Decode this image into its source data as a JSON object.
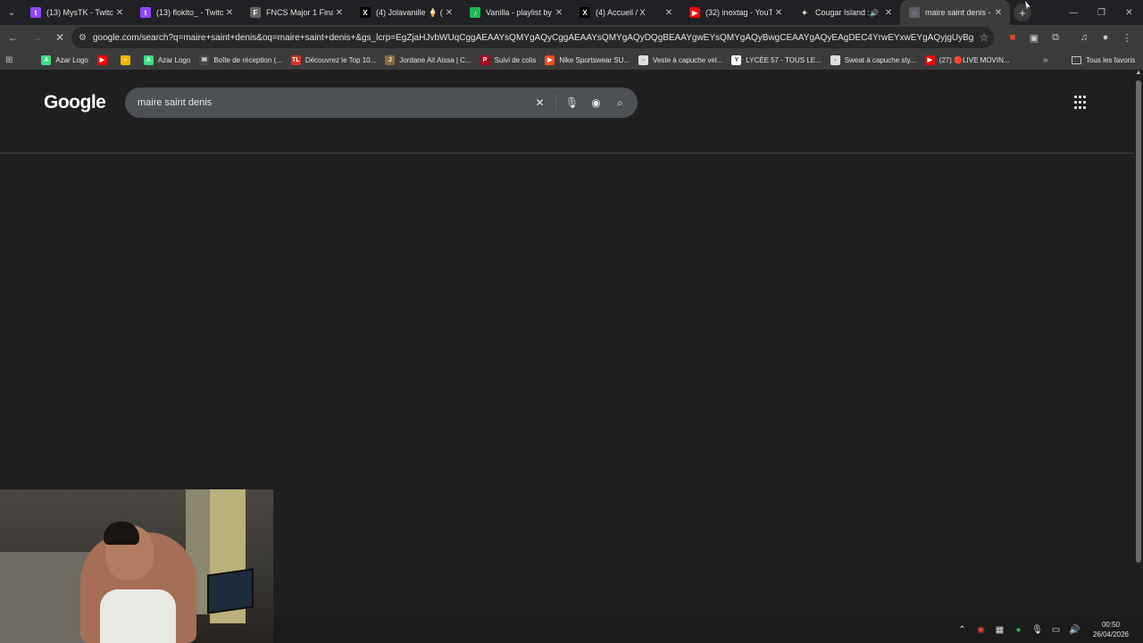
{
  "tabs": [
    {
      "title": "(13) MysTK - Twitch",
      "favicon_color": "#9146ff",
      "glyph": "t"
    },
    {
      "title": "(13) flokito_ - Twitch",
      "favicon_color": "#9146ff",
      "glyph": "t"
    },
    {
      "title": "FNCS Major 1 Finals",
      "favicon_color": "#666666",
      "glyph": "F"
    },
    {
      "title": "(4) Jolavanille 🍦 (@",
      "favicon_color": "#000000",
      "glyph": "X"
    },
    {
      "title": "Vanilla - playlist by Je",
      "favicon_color": "#1db954",
      "glyph": "♪"
    },
    {
      "title": "(4) Accueil / X",
      "favicon_color": "#000000",
      "glyph": "X"
    },
    {
      "title": "(32) inoxtag - YouTub",
      "favicon_color": "#ff0000",
      "glyph": "▶"
    },
    {
      "title": "Cougar Island : É",
      "favicon_color": "#222222",
      "glyph": "✦"
    },
    {
      "title": "maire saint denis - R",
      "favicon_color": "#5f6368",
      "glyph": "◌"
    }
  ],
  "toolbar": {
    "url": "google.com/search?q=maire+saint+denis&oq=maire+saint+denis+&gs_lcrp=EgZjaHJvbWUqCggAEAAYsQMYgAQyCggAEAAYsQMYgAQyDQgBEAAYgwEYsQMYgAQyBwgCEAAYgAQyEAgDEC4YrwEYxwEYgAQyjgUyBggEEAAYAzIHCAUQABi..."
  },
  "bookmarks": [
    {
      "label": "Azar Logo",
      "color": "#3ddc84",
      "glyph": "A"
    },
    {
      "label": "",
      "color": "#ff0000",
      "glyph": "▶"
    },
    {
      "label": "",
      "color": "#f4b400",
      "glyph": "▪"
    },
    {
      "label": "Azar Logo",
      "color": "#3ddc84",
      "glyph": "A"
    },
    {
      "label": "Boîte de réception (...",
      "color": "#4a4a4a",
      "glyph": "✉"
    },
    {
      "label": "Découvrez le Top 10...",
      "color": "#d93025",
      "glyph": "TL"
    },
    {
      "label": "Jordane Ait Aissa | C...",
      "color": "#8a6d3b",
      "glyph": "J"
    },
    {
      "label": "Suivi de colis",
      "color": "#b00020",
      "glyph": "P"
    },
    {
      "label": "Nike Sportswear SU...",
      "color": "#f25022",
      "glyph": "▶"
    },
    {
      "label": "Veste à capuche vel...",
      "color": "#e0e0e0",
      "glyph": "▫"
    },
    {
      "label": "LYCÉE 57 - TOUS LE...",
      "color": "#ffffff",
      "glyph": "Y"
    },
    {
      "label": "Sweat à capuche sty...",
      "color": "#e0e0e0",
      "glyph": "▫"
    },
    {
      "label": "(27) 🔴LIVE MOVIN...",
      "color": "#ff0000",
      "glyph": "▶"
    }
  ],
  "bookmarks_all": "Tous les favoris",
  "page": {
    "logo": "Google",
    "search_value": "maire saint denis"
  },
  "taskbar": {
    "time": "00:50",
    "date": "26/04/2026"
  }
}
